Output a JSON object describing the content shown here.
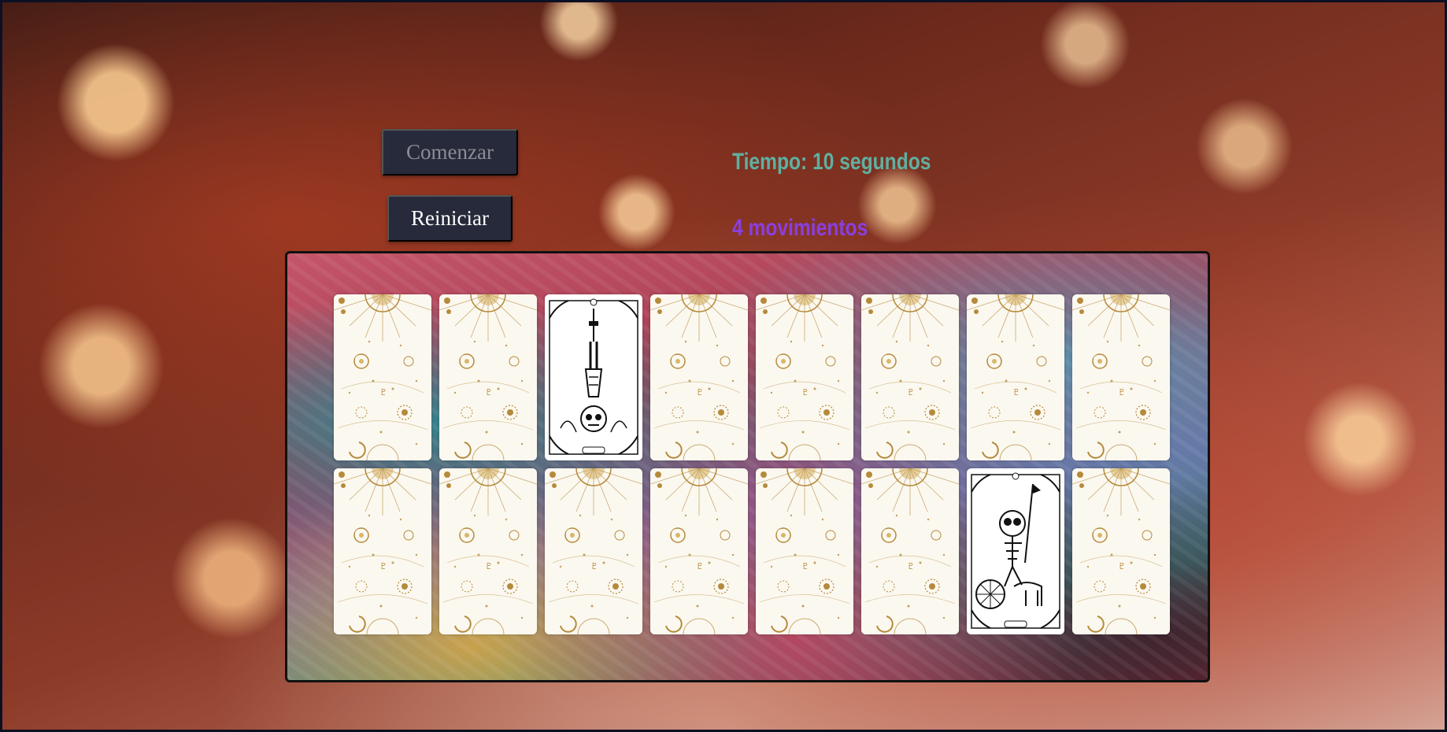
{
  "controls": {
    "start_label": "Comenzar",
    "restart_label": "Reiniciar"
  },
  "status": {
    "timer_text": "Tiempo: 10 segundos",
    "moves_text": "4 movimientos"
  },
  "colors": {
    "timer": "#5fb0a0",
    "moves": "#8a3fe0",
    "button_bg": "#262a3a",
    "card_back_gold": "#b58a3a"
  },
  "board": {
    "rows": 2,
    "columns": 8,
    "cards": [
      {
        "state": "back"
      },
      {
        "state": "back"
      },
      {
        "state": "face-up",
        "figure": "hanged-skeleton"
      },
      {
        "state": "back"
      },
      {
        "state": "back"
      },
      {
        "state": "back"
      },
      {
        "state": "back"
      },
      {
        "state": "back"
      },
      {
        "state": "back"
      },
      {
        "state": "back"
      },
      {
        "state": "back"
      },
      {
        "state": "back"
      },
      {
        "state": "back"
      },
      {
        "state": "back"
      },
      {
        "state": "face-up",
        "figure": "chariot-skeleton"
      },
      {
        "state": "back"
      }
    ]
  }
}
